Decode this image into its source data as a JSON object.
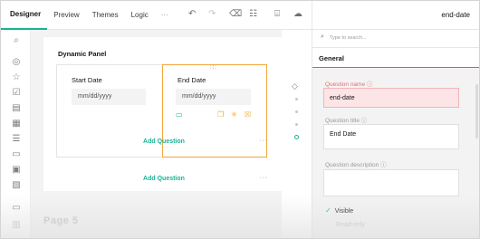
{
  "topbar": {
    "tabs": [
      "Designer",
      "Preview",
      "Themes",
      "Logic"
    ],
    "more": "···",
    "undo_icon": "undo-icon",
    "redo_icon": "redo-icon",
    "eraser_icon": "eraser-icon",
    "settings_icon": "settings-icon",
    "book_icon": "book-icon",
    "upload_icon": "upload-icon"
  },
  "right_header": {
    "title": "end-date"
  },
  "canvas": {
    "panel_title": "Dynamic Panel",
    "start_question": {
      "label": "Start Date",
      "placeholder": "mm/dd/yyyy"
    },
    "end_question": {
      "label": "End Date",
      "placeholder": "mm/dd/yyyy"
    },
    "add_question_inner": "Add Question",
    "add_question_outer": "Add Question",
    "dots": "···",
    "page_label": "Page 5"
  },
  "props": {
    "search_placeholder": "Type to search...",
    "section": "General",
    "name_label": "Question name",
    "name_value": "end-date",
    "title_label": "Question title",
    "title_value": "End Date",
    "description_label": "Question description",
    "visible_label": "Visible",
    "readonly_label": "Read-only"
  },
  "colors": {
    "accent": "#19b394",
    "selection": "#f3a73b",
    "error_bg": "#fde4e6",
    "error_text": "#e56d73"
  }
}
